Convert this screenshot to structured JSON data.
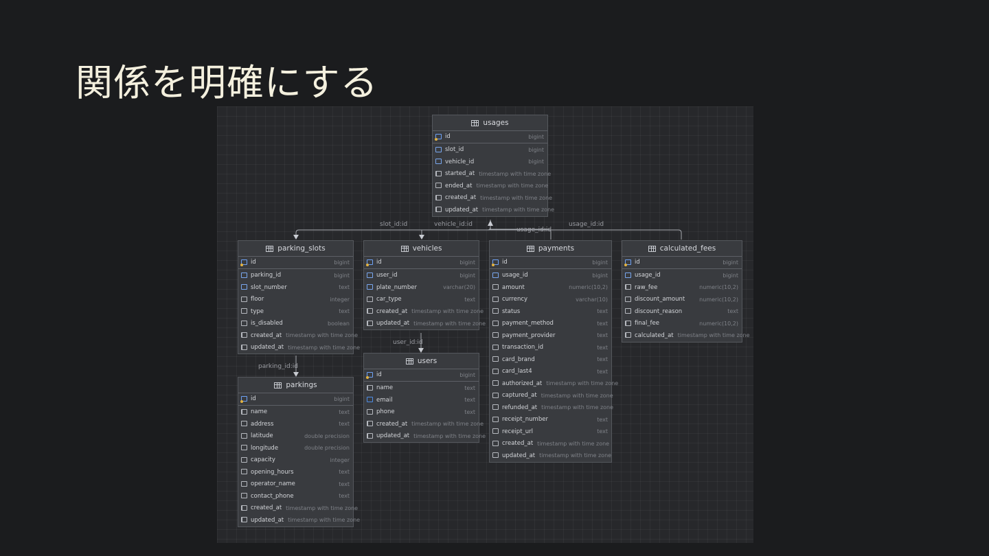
{
  "slide": {
    "title": "関係を明確にする"
  },
  "relations": [
    {
      "label": "slot_id:id"
    },
    {
      "label": "vehicle_id:id"
    },
    {
      "label": "usage_id:id"
    },
    {
      "label": "usage_id:id"
    },
    {
      "label": "user_id:id"
    },
    {
      "label": "parking_id:id"
    }
  ],
  "tables": {
    "usages": {
      "name": "usages",
      "columns": [
        {
          "name": "id",
          "type": "bigint"
        },
        {
          "name": "slot_id",
          "type": "bigint"
        },
        {
          "name": "vehicle_id",
          "type": "bigint"
        },
        {
          "name": "started_at",
          "type": "timestamp with time zone"
        },
        {
          "name": "ended_at",
          "type": "timestamp with time zone"
        },
        {
          "name": "created_at",
          "type": "timestamp with time zone"
        },
        {
          "name": "updated_at",
          "type": "timestamp with time zone"
        }
      ]
    },
    "parking_slots": {
      "name": "parking_slots",
      "columns": [
        {
          "name": "id",
          "type": "bigint"
        },
        {
          "name": "parking_id",
          "type": "bigint"
        },
        {
          "name": "slot_number",
          "type": "text"
        },
        {
          "name": "floor",
          "type": "integer"
        },
        {
          "name": "type",
          "type": "text"
        },
        {
          "name": "is_disabled",
          "type": "boolean"
        },
        {
          "name": "created_at",
          "type": "timestamp with time zone"
        },
        {
          "name": "updated_at",
          "type": "timestamp with time zone"
        }
      ]
    },
    "vehicles": {
      "name": "vehicles",
      "columns": [
        {
          "name": "id",
          "type": "bigint"
        },
        {
          "name": "user_id",
          "type": "bigint"
        },
        {
          "name": "plate_number",
          "type": "varchar(20)"
        },
        {
          "name": "car_type",
          "type": "text"
        },
        {
          "name": "created_at",
          "type": "timestamp with time zone"
        },
        {
          "name": "updated_at",
          "type": "timestamp with time zone"
        }
      ]
    },
    "payments": {
      "name": "payments",
      "columns": [
        {
          "name": "id",
          "type": "bigint"
        },
        {
          "name": "usage_id",
          "type": "bigint"
        },
        {
          "name": "amount",
          "type": "numeric(10,2)"
        },
        {
          "name": "currency",
          "type": "varchar(10)"
        },
        {
          "name": "status",
          "type": "text"
        },
        {
          "name": "payment_method",
          "type": "text"
        },
        {
          "name": "payment_provider",
          "type": "text"
        },
        {
          "name": "transaction_id",
          "type": "text"
        },
        {
          "name": "card_brand",
          "type": "text"
        },
        {
          "name": "card_last4",
          "type": "text"
        },
        {
          "name": "authorized_at",
          "type": "timestamp with time zone"
        },
        {
          "name": "captured_at",
          "type": "timestamp with time zone"
        },
        {
          "name": "refunded_at",
          "type": "timestamp with time zone"
        },
        {
          "name": "receipt_number",
          "type": "text"
        },
        {
          "name": "receipt_url",
          "type": "text"
        },
        {
          "name": "created_at",
          "type": "timestamp with time zone"
        },
        {
          "name": "updated_at",
          "type": "timestamp with time zone"
        }
      ]
    },
    "calculated_fees": {
      "name": "calculated_fees",
      "columns": [
        {
          "name": "id",
          "type": "bigint"
        },
        {
          "name": "usage_id",
          "type": "bigint"
        },
        {
          "name": "raw_fee",
          "type": "numeric(10,2)"
        },
        {
          "name": "discount_amount",
          "type": "numeric(10,2)"
        },
        {
          "name": "discount_reason",
          "type": "text"
        },
        {
          "name": "final_fee",
          "type": "numeric(10,2)"
        },
        {
          "name": "calculated_at",
          "type": "timestamp with time zone"
        }
      ]
    },
    "users": {
      "name": "users",
      "columns": [
        {
          "name": "id",
          "type": "bigint"
        },
        {
          "name": "name",
          "type": "text"
        },
        {
          "name": "email",
          "type": "text"
        },
        {
          "name": "phone",
          "type": "text"
        },
        {
          "name": "created_at",
          "type": "timestamp with time zone"
        },
        {
          "name": "updated_at",
          "type": "timestamp with time zone"
        }
      ]
    },
    "parkings": {
      "name": "parkings",
      "columns": [
        {
          "name": "id",
          "type": "bigint"
        },
        {
          "name": "name",
          "type": "text"
        },
        {
          "name": "address",
          "type": "text"
        },
        {
          "name": "latitude",
          "type": "double precision"
        },
        {
          "name": "longitude",
          "type": "double precision"
        },
        {
          "name": "capacity",
          "type": "integer"
        },
        {
          "name": "opening_hours",
          "type": "text"
        },
        {
          "name": "operator_name",
          "type": "text"
        },
        {
          "name": "contact_phone",
          "type": "text"
        },
        {
          "name": "created_at",
          "type": "timestamp with time zone"
        },
        {
          "name": "updated_at",
          "type": "timestamp with time zone"
        }
      ]
    }
  }
}
